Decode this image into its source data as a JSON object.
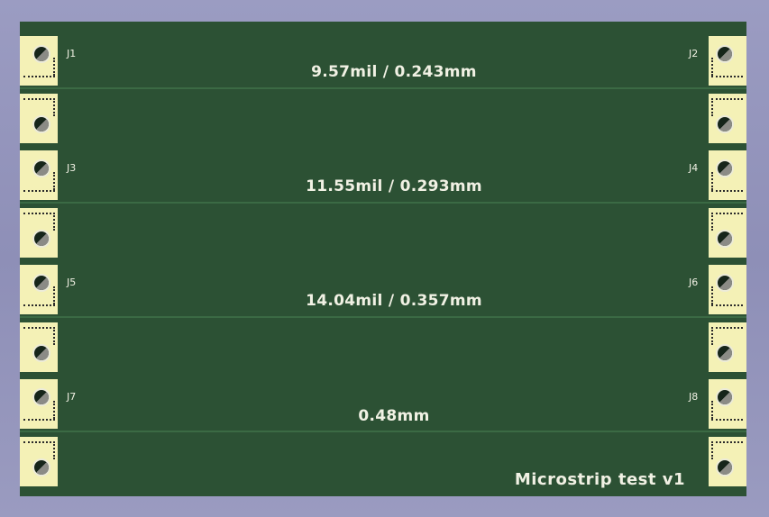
{
  "board": {
    "title": "Microstrip test v1",
    "traces": [
      {
        "label": "9.57mil / 0.243mm"
      },
      {
        "label": "11.55mil / 0.293mm"
      },
      {
        "label": "14.04mil / 0.357mm"
      },
      {
        "label": "0.48mm"
      }
    ],
    "connectors_left": [
      "J1",
      "J3",
      "J5",
      "J7"
    ],
    "connectors_right": [
      "J2",
      "J4",
      "J6",
      "J8"
    ]
  },
  "colors": {
    "background": "#9b9cc2",
    "board": "#2c5134",
    "trace": "#3b6a44",
    "pad": "#f4f1b6",
    "silkscreen": "#f1f1e4"
  },
  "icons": {
    "pad": "sma-edge-connector-pad",
    "hole": "drill-hole-icon"
  }
}
